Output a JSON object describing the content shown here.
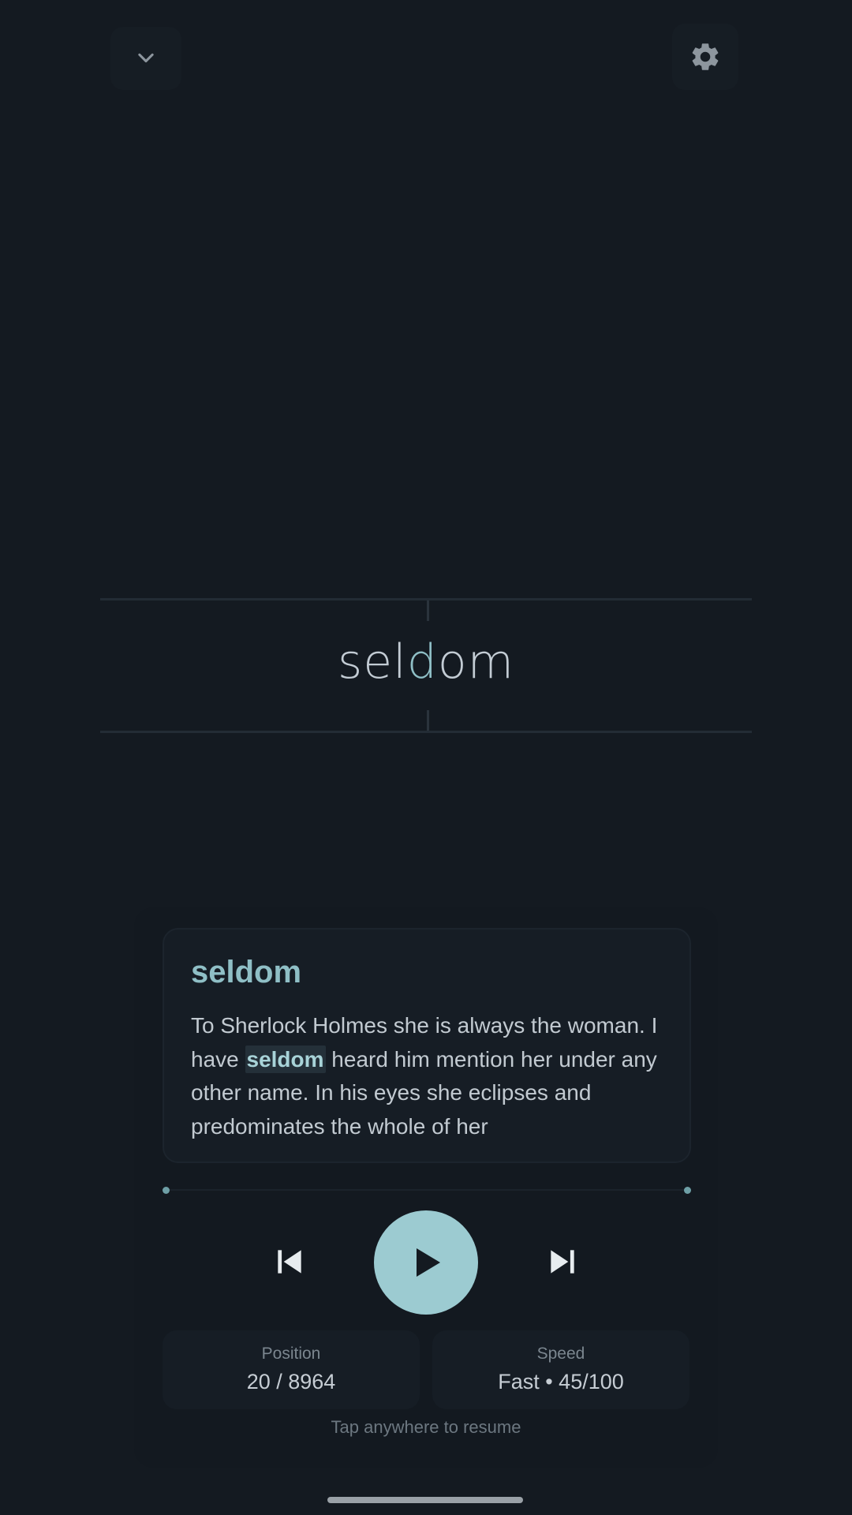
{
  "header": {
    "collapse_icon": "chevron-down-icon",
    "settings_icon": "gear-icon"
  },
  "reader": {
    "word_before": "sel",
    "word_focus": "d",
    "word_after": "om"
  },
  "context": {
    "word": "seldom",
    "text_before": "To Sherlock Holmes she is always the woman. I have ",
    "highlight": "seldom",
    "text_after": " heard him mention her under any other name. In his eyes she eclipses and predominates the whole of her"
  },
  "controls": {
    "prev_icon": "skip-previous-icon",
    "play_icon": "play-icon",
    "next_icon": "skip-next-icon"
  },
  "stats": {
    "position_label": "Position",
    "position_value": "20 / 8964",
    "speed_label": "Speed",
    "speed_value": "Fast • 45/100"
  },
  "hint": "Tap anywhere to resume",
  "colors": {
    "accent": "#9ccbd1",
    "background": "#141a21"
  }
}
